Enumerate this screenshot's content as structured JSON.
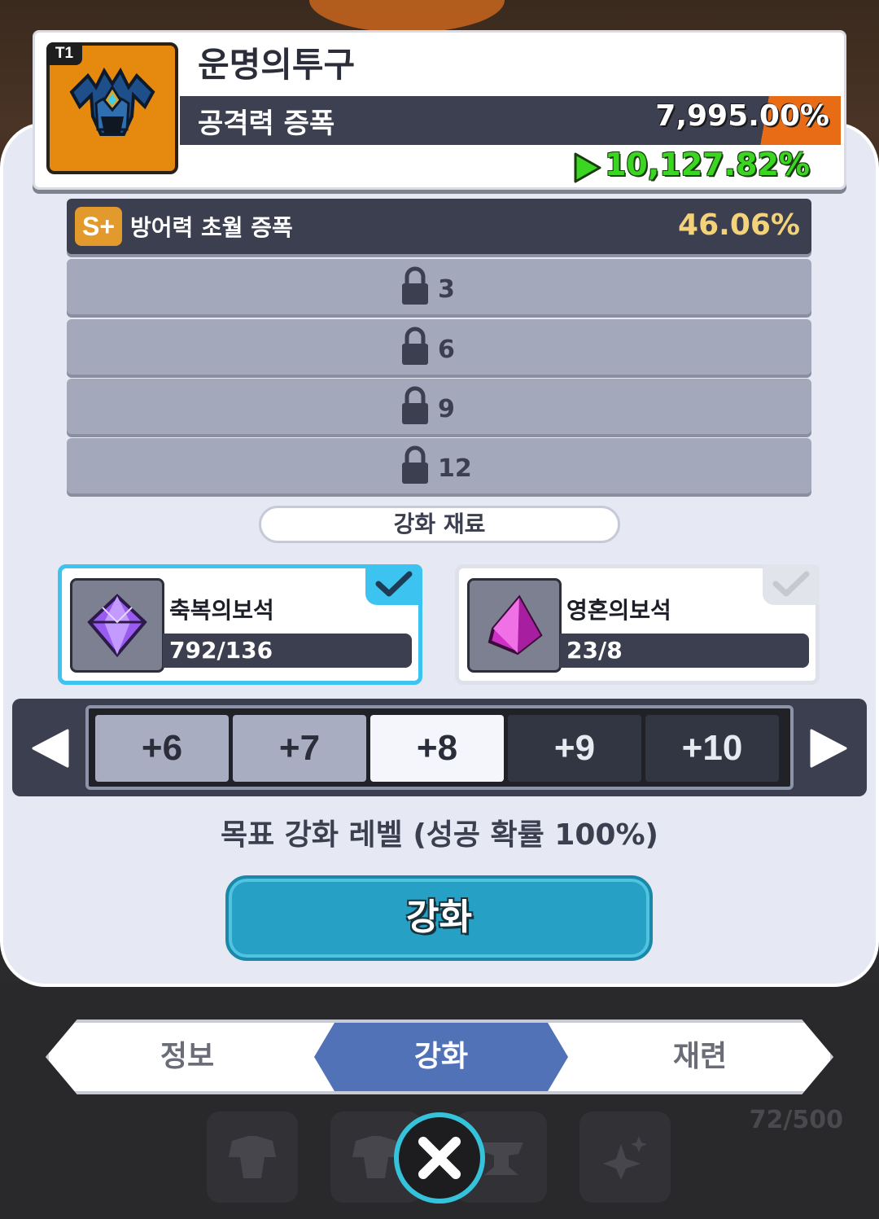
{
  "item": {
    "tier": "T1",
    "name": "운명의투구",
    "stat_label": "공격력 증폭",
    "stat_current": "7,995.00%",
    "stat_next": "10,127.82%"
  },
  "options": {
    "main": {
      "grade": "S+",
      "name": "방어력 초월 증폭",
      "value": "46.06%"
    },
    "locked": [
      {
        "unlock_level": "3"
      },
      {
        "unlock_level": "6"
      },
      {
        "unlock_level": "9"
      },
      {
        "unlock_level": "12"
      }
    ]
  },
  "materials": {
    "title": "강화 재료",
    "items": [
      {
        "name": "축복의보석",
        "count": "792/136",
        "selected": true
      },
      {
        "name": "영혼의보석",
        "count": "23/8",
        "selected": false
      }
    ]
  },
  "levels": [
    "+6",
    "+7",
    "+8",
    "+9",
    "+10"
  ],
  "selected_level": "+8",
  "target_text": "목표 강화 레벨 (성공 확률 100%)",
  "enhance_button": "강화",
  "tabs": [
    "정보",
    "강화",
    "재련"
  ],
  "active_tab": "강화",
  "inventory_count": "72/500",
  "colors": {
    "accent": "#26a0c4",
    "tab_active": "#5272b8",
    "stat_up": "#3ad622",
    "selected_border": "#3cc3f0"
  }
}
